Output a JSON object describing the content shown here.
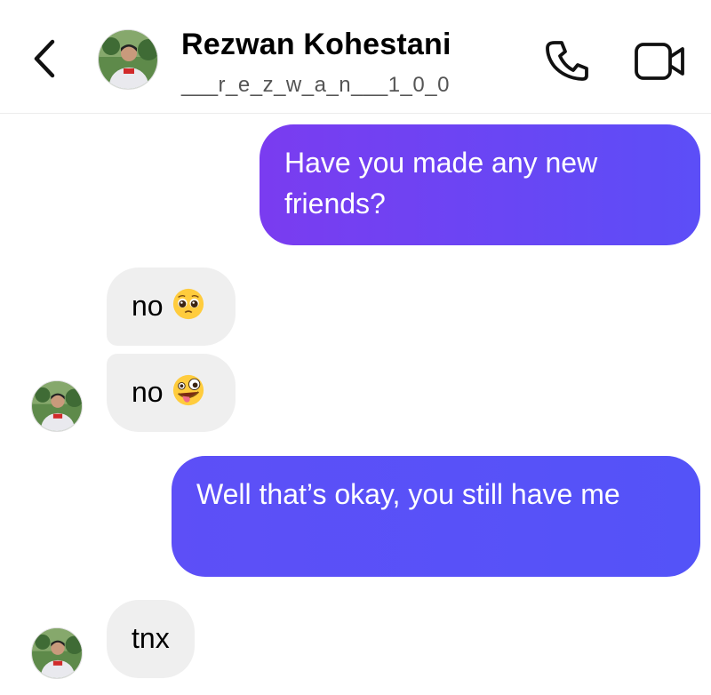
{
  "header": {
    "name": "Rezwan Kohestani",
    "handle": "___r_e_z_w_a_n___1_0_0",
    "back_icon": "chevron-left-icon",
    "call_icon": "phone-icon",
    "video_icon": "video-camera-icon"
  },
  "messages": [
    {
      "direction": "sent",
      "text": "Have you made any new friends?"
    },
    {
      "direction": "received",
      "text": "no",
      "emoji": "pleading-face-emoji"
    },
    {
      "direction": "received",
      "text": "no",
      "emoji": "zany-face-emoji"
    },
    {
      "direction": "sent",
      "text": "Well that’s okay, you still have me"
    },
    {
      "direction": "received",
      "text": "tnx"
    }
  ],
  "colors": {
    "sent_bubble_start": "#7a3cf0",
    "sent_bubble_end": "#5453f8",
    "received_bubble": "#efefef"
  }
}
